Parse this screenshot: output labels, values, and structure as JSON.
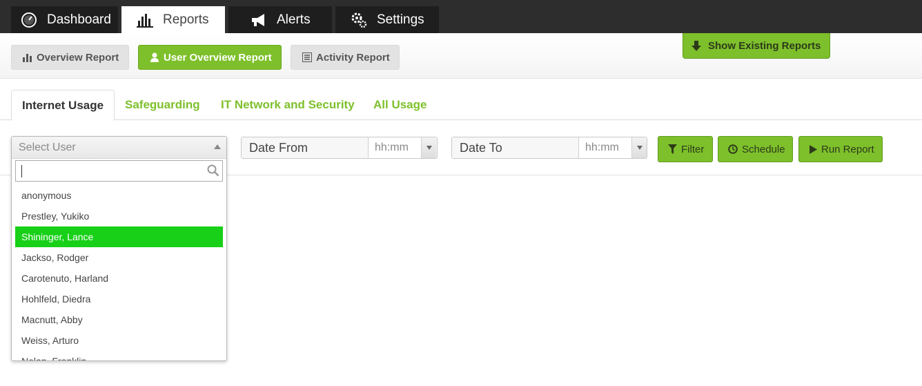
{
  "nav": {
    "tabs": [
      {
        "label": "Dashboard",
        "icon": "gauge-icon"
      },
      {
        "label": "Reports",
        "icon": "bar-chart-icon"
      },
      {
        "label": "Alerts",
        "icon": "megaphone-icon"
      },
      {
        "label": "Settings",
        "icon": "gears-icon"
      }
    ],
    "active": "Reports"
  },
  "report_buttons": [
    {
      "label": "Overview Report",
      "icon": "bar-chart-icon"
    },
    {
      "label": "User Overview Report",
      "icon": "user-icon"
    },
    {
      "label": "Activity Report",
      "icon": "list-icon"
    }
  ],
  "active_report": "User Overview Report",
  "show_existing_label": "Show Existing Reports",
  "category_tabs": [
    "Internet Usage",
    "Safeguarding",
    "IT Network and Security",
    "All Usage"
  ],
  "active_category": "Internet Usage",
  "user_select": {
    "placeholder": "Select User",
    "search_value": "",
    "options": [
      "anonymous",
      "Prestley, Yukiko",
      "Shininger, Lance",
      "Jackso, Rodger",
      "Carotenuto, Harland",
      "Hohlfeld, Diedra",
      "Macnutt, Abby",
      "Weiss, Arturo",
      "Nolan, Franklin"
    ],
    "highlighted": "Shininger, Lance"
  },
  "date_from": {
    "label": "Date From",
    "time_placeholder": "hh:mm"
  },
  "date_to": {
    "label": "Date To",
    "time_placeholder": "hh:mm"
  },
  "actions": {
    "filter": "Filter",
    "schedule": "Schedule",
    "run": "Run Report"
  },
  "colors": {
    "accent_green": "#7dc02b",
    "highlight_green": "#17d017",
    "nav_dark": "#2d2d2d"
  }
}
